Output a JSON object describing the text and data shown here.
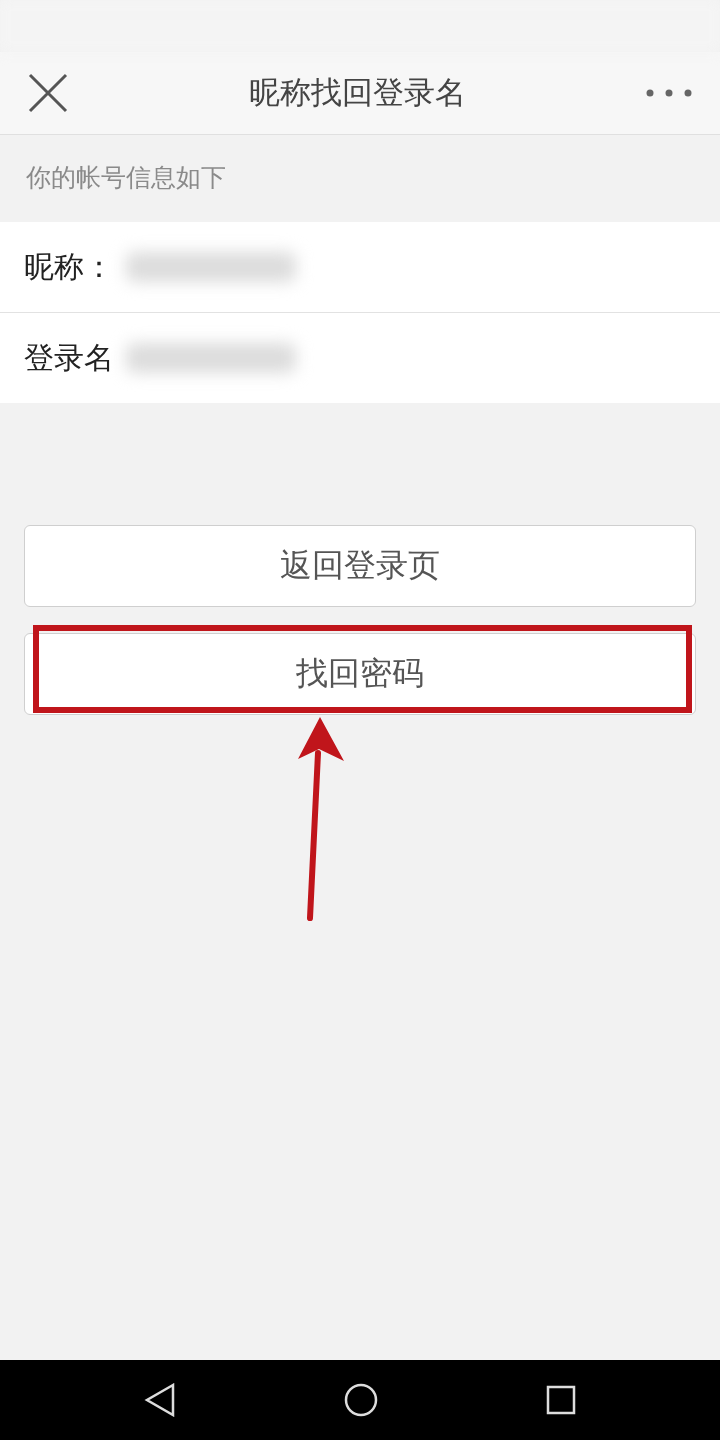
{
  "header": {
    "title": "昵称找回登录名"
  },
  "hint": "你的帐号信息如下",
  "account_rows": [
    {
      "label": "昵称："
    },
    {
      "label": "登录名"
    }
  ],
  "buttons": [
    {
      "label": "返回登录页",
      "highlighted": false
    },
    {
      "label": "找回密码",
      "highlighted": true
    }
  ]
}
